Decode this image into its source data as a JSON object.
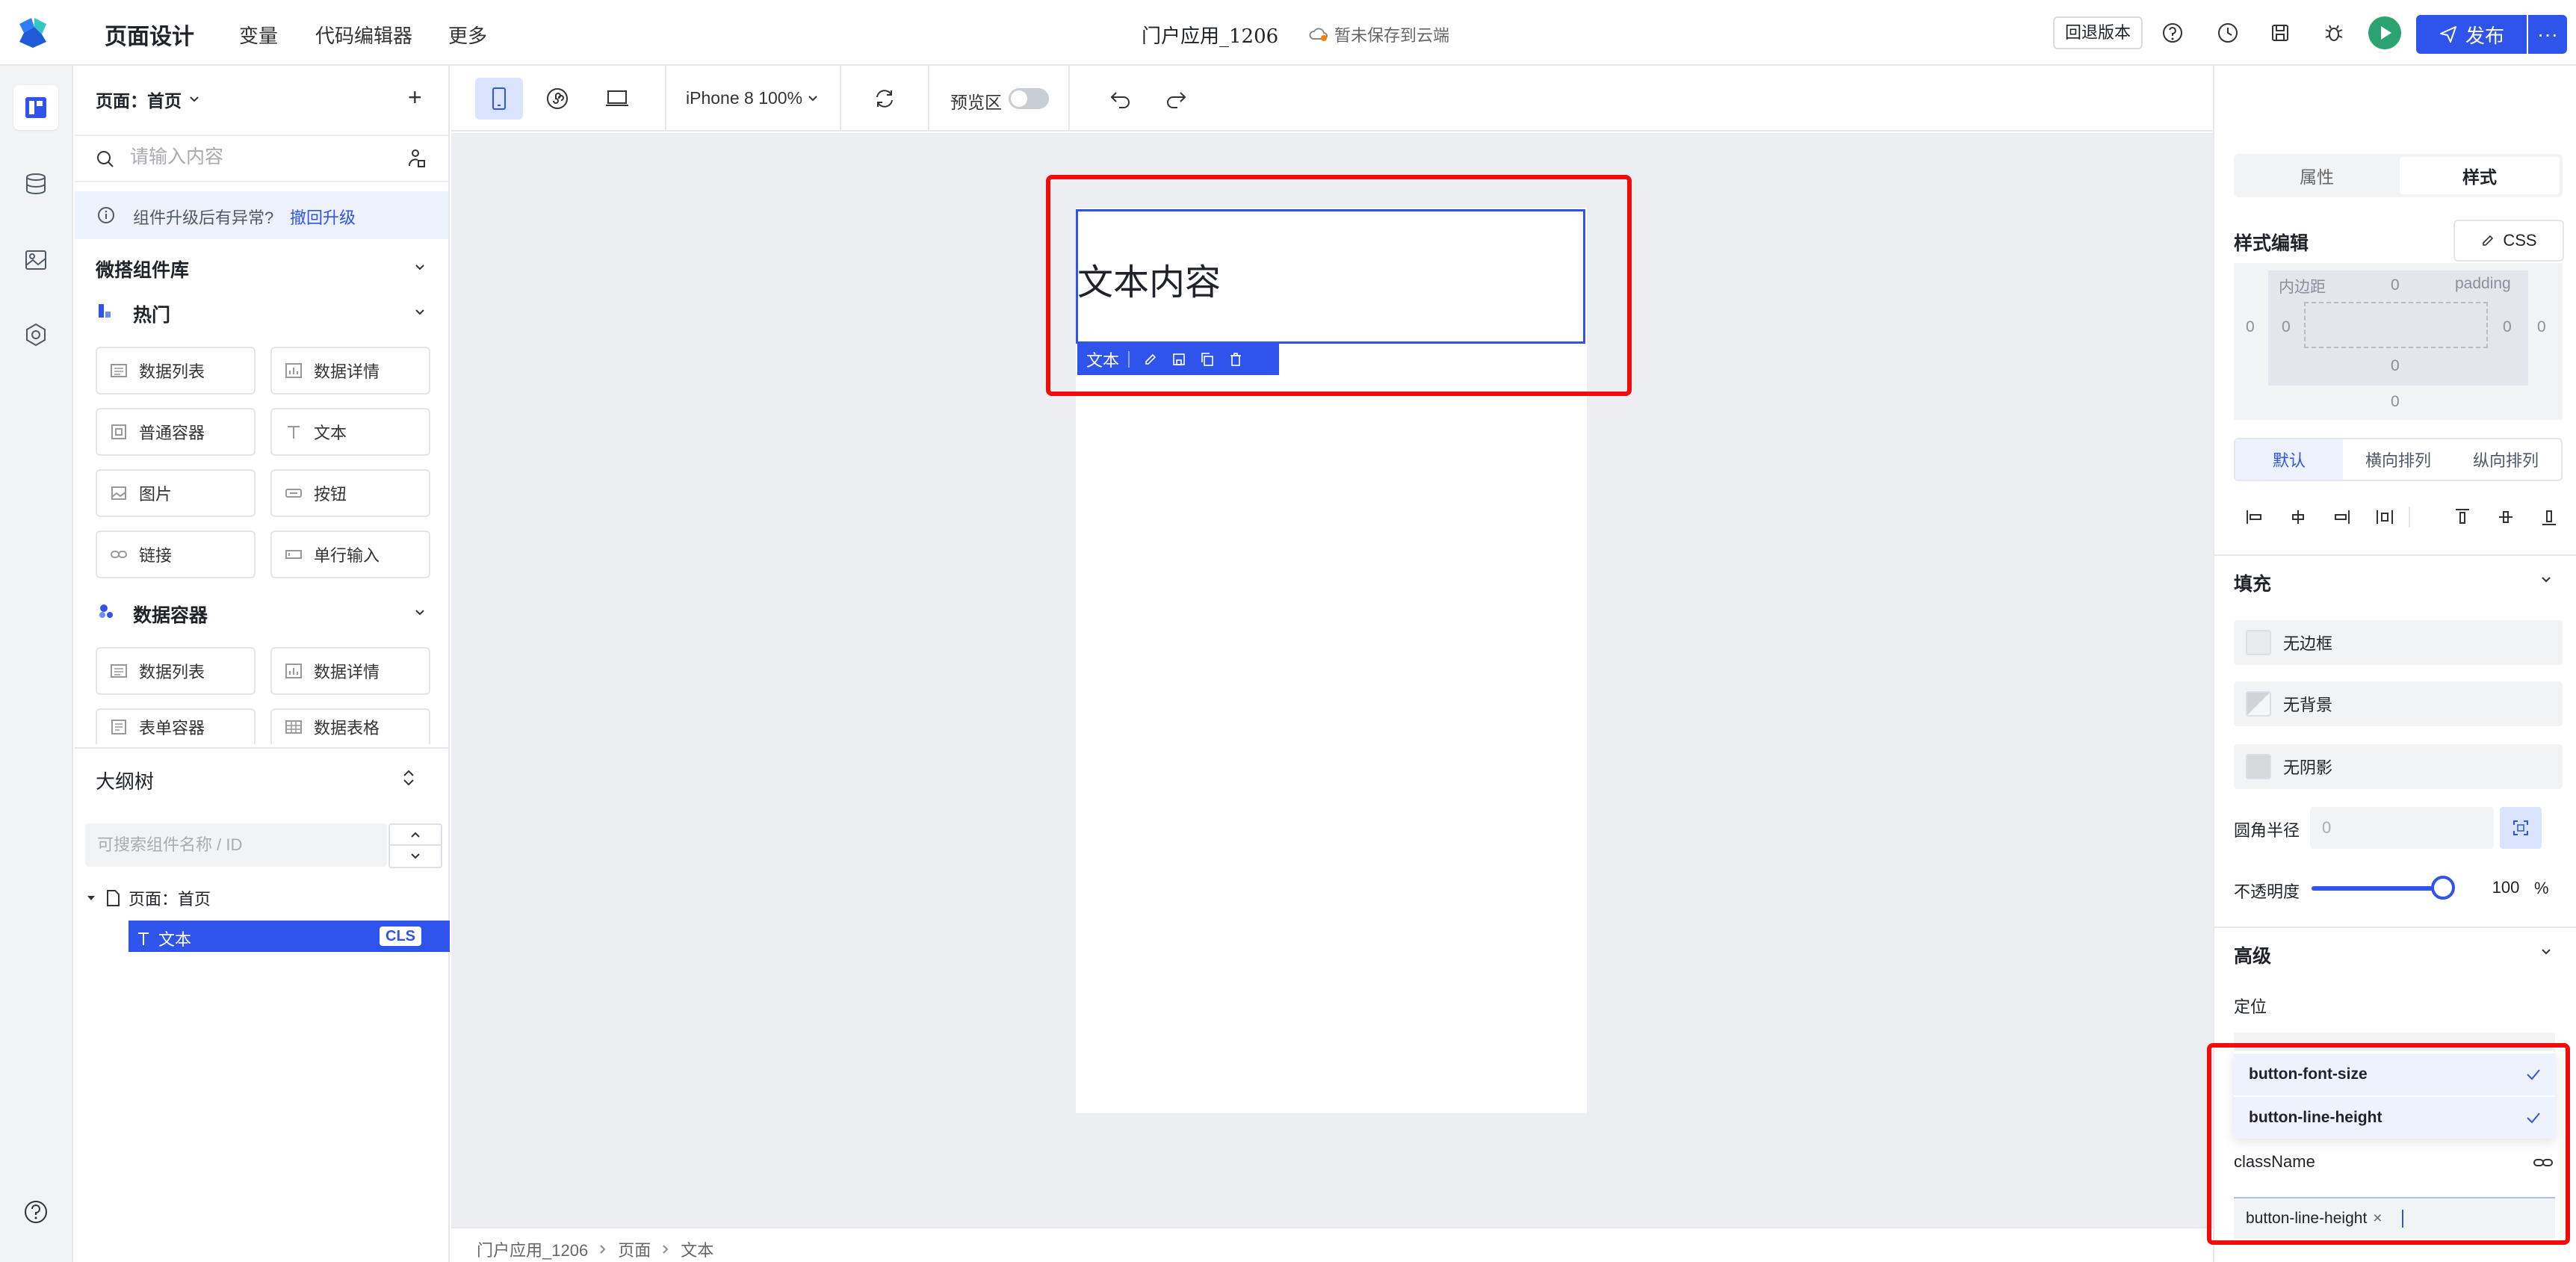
{
  "header": {
    "app_title": "页面设计",
    "nav": [
      "变量",
      "代码编辑器",
      "更多"
    ],
    "doc_name": "门户应用_1206",
    "save_status": "暂未保存到云端",
    "rollback_label": "回退版本",
    "publish_label": "发布"
  },
  "components_panel": {
    "page_select": "页面：首页",
    "search_placeholder": "请输入内容",
    "notice_text": "组件升级后有异常?",
    "notice_link": "撤回升级",
    "library_title": "微搭组件库",
    "groups": [
      {
        "title": "热门",
        "items": [
          "数据列表",
          "数据详情",
          "普通容器",
          "文本",
          "图片",
          "按钮",
          "链接",
          "单行输入"
        ]
      },
      {
        "title": "数据容器",
        "items": [
          "数据列表",
          "数据详情",
          "表单容器",
          "数据表格"
        ]
      }
    ]
  },
  "outline": {
    "title": "大纲树",
    "search_placeholder": "可搜索组件名称 / ID",
    "root_node": "页面：首页",
    "selected_node": "文本",
    "selected_badge": "CLS"
  },
  "toolbar": {
    "device": "iPhone 8 100%",
    "preview_label": "预览区"
  },
  "canvas": {
    "text_content": "文本内容",
    "selection_label": "文本"
  },
  "breadcrumb": [
    "门户应用_1206",
    "页面",
    "文本"
  ],
  "style_panel": {
    "tabs": [
      "属性",
      "样式"
    ],
    "active_tab": "样式",
    "section_title": "样式编辑",
    "css_button": "CSS",
    "box_model": {
      "inner_label": "内边距",
      "padding_label": "padding",
      "padding_top": "0",
      "padding_left": "0",
      "padding_right": "0",
      "padding_bottom": "0",
      "margin_left": "0",
      "margin_right": "0",
      "margin_bottom": "0"
    },
    "layout_modes": [
      "默认",
      "横向排列",
      "纵向排列"
    ],
    "active_layout": "默认",
    "fill_title": "填充",
    "fill_rows": [
      "无边框",
      "无背景",
      "无阴影"
    ],
    "radius_label": "圆角半径",
    "radius_value": "0",
    "opacity_label": "不透明度",
    "opacity_value": "100",
    "opacity_unit": "%",
    "opacity_fraction": 1.0,
    "advanced_title": "高级",
    "position_label": "定位",
    "class_options": [
      "button-font-size",
      "button-line-height"
    ],
    "classname_label": "className",
    "classname_tag": "button-line-height"
  },
  "colors": {
    "primary": "#2f54eb",
    "highlight_red": "#f00d0d",
    "run_green": "#2ba471"
  }
}
